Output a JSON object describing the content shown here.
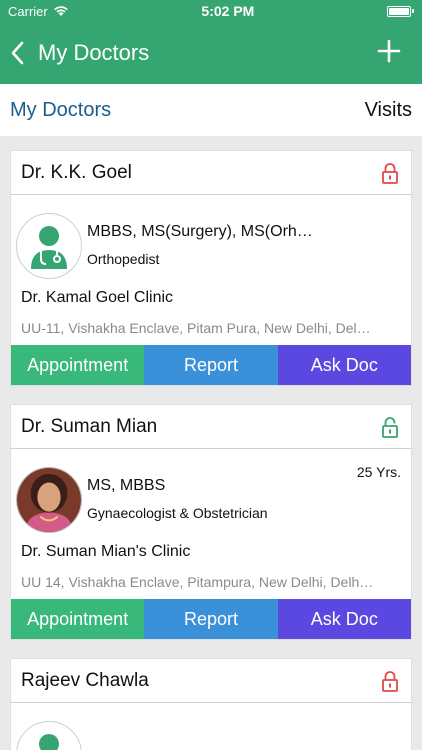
{
  "status_bar": {
    "carrier": "Carrier",
    "time": "5:02 PM"
  },
  "nav": {
    "back_icon": "chevron-left-icon",
    "title": "My Doctors",
    "add_icon": "plus-icon"
  },
  "tabs": {
    "doctors": "My Doctors",
    "visits": "Visits"
  },
  "colors": {
    "brand": "#35a671",
    "appointment": "#38b87a",
    "report": "#3a90d9",
    "ask_doc": "#5b48e0",
    "lock_red": "#e04a4a",
    "lock_green": "#35a671"
  },
  "doctors": [
    {
      "name": "Dr. K.K. Goel",
      "lock": "locked",
      "avatar": "doctor-placeholder",
      "degree": "MBBS, MS(Surgery), MS(Orh…",
      "speciality": "Orthopedist",
      "experience": "",
      "clinic": "Dr. Kamal Goel Clinic",
      "address": "UU-11, Vishakha Enclave, Pitam Pura, New Delhi, Del…",
      "actions": {
        "appointment": "Appointment",
        "report": "Report",
        "ask": "Ask Doc"
      }
    },
    {
      "name": "Dr. Suman Mian",
      "lock": "unlocked",
      "avatar": "photo",
      "degree": "MS, MBBS",
      "speciality": "Gynaecologist & Obstetrician",
      "experience": "25 Yrs.",
      "clinic": "Dr. Suman Mian's Clinic",
      "address": "UU 14, Vishakha Enclave, Pitampura, New Delhi, Delh…",
      "actions": {
        "appointment": "Appointment",
        "report": "Report",
        "ask": "Ask Doc"
      }
    },
    {
      "name": "Rajeev Chawla",
      "lock": "locked",
      "avatar": "doctor-placeholder"
    }
  ]
}
